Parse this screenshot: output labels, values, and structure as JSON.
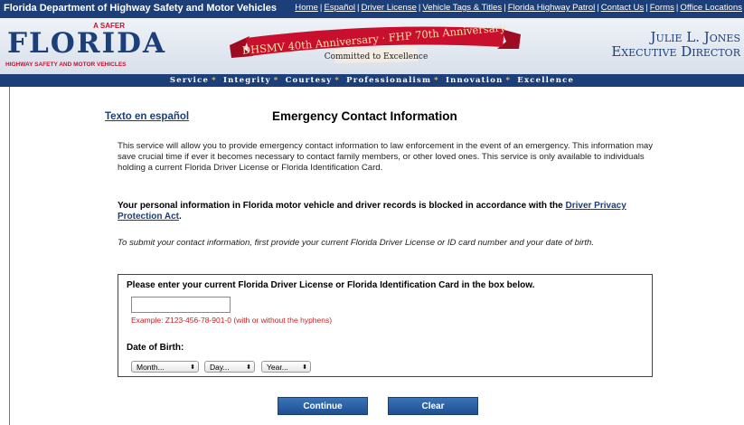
{
  "header": {
    "agency": "Florida Department of Highway Safety and Motor Vehicles",
    "links": [
      "Home",
      "Español",
      "Driver License",
      "Vehicle Tags & Titles",
      "Florida Highway Patrol",
      "Contact Us",
      "Forms",
      "Office Locations"
    ]
  },
  "banner": {
    "logo_tag": "A SAFER",
    "logo_text": "FLORIDA",
    "logo_sub": "HIGHWAY SAFETY AND MOTOR VEHICLES",
    "ribbon_title": "DHSMV 40th Anniversary · FHP 70th Anniversary",
    "ribbon_sub": "Committed to Excellence",
    "director_name": "Julie L. Jones",
    "director_title": "Executive Director"
  },
  "values": [
    "Service",
    "Integrity",
    "Courtesy",
    "Professionalism",
    "Innovation",
    "Excellence"
  ],
  "page": {
    "spanish_link": "Texto en español",
    "title": "Emergency Contact Information",
    "intro": "This service will allow you to provide emergency contact information to law enforcement in the event of an emergency. This information may save crucial time if ever it becomes necessary to contact family members, or other loved ones. This service is only available to individuals holding a current Florida Driver License or Florida Identification Card.",
    "privacy_text": "Your personal information in Florida motor vehicle and driver records is blocked in accordance with the",
    "privacy_link": "Driver Privacy Protection Act",
    "instructions": "To submit your contact information, first provide your current Florida Driver License or ID card number and your date of birth."
  },
  "form": {
    "prompt": "Please enter your current Florida Driver License or Florida Identification Card in the box below.",
    "dl_value": "",
    "example": "Example: Z123-456-78-901-0 (with or without the hyphens)",
    "dob_label": "Date of Birth:",
    "month": "Month...",
    "day": "Day...",
    "year": "Year..."
  },
  "buttons": {
    "continue": "Continue",
    "clear": "Clear"
  },
  "colors": {
    "navy": "#1c3f7a",
    "ribbon_red": "#c8102e",
    "example_red": "#c81f1f",
    "gold": "#e6c15a"
  }
}
